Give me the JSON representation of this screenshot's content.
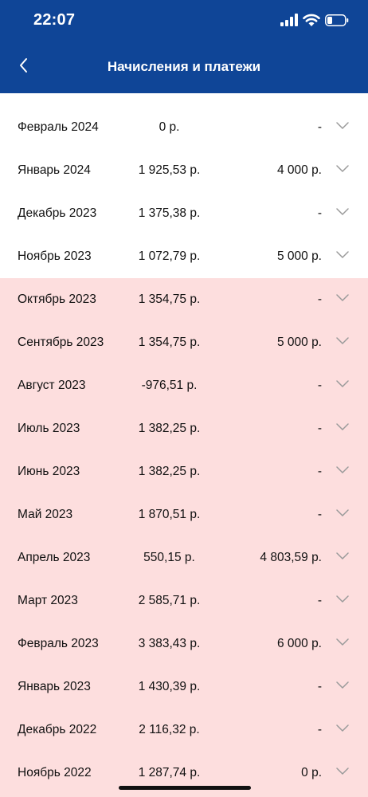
{
  "status_bar": {
    "time": "22:07"
  },
  "header": {
    "title": "Начисления и платежи"
  },
  "colors": {
    "header_bg": "#0f4597",
    "highlight_bg": "#fddede"
  },
  "rows": [
    {
      "month": "Февраль 2024",
      "charge": "0 р.",
      "payment": "-"
    },
    {
      "month": "Январь 2024",
      "charge": "1 925,53 р.",
      "payment": "4 000 р."
    },
    {
      "month": "Декабрь 2023",
      "charge": "1 375,38 р.",
      "payment": "-"
    },
    {
      "month": "Ноябрь 2023",
      "charge": "1 072,79 р.",
      "payment": "5 000 р."
    },
    {
      "month": "Октябрь 2023",
      "charge": "1 354,75 р.",
      "payment": "-"
    },
    {
      "month": "Сентябрь 2023",
      "charge": "1 354,75 р.",
      "payment": "5 000 р."
    },
    {
      "month": "Август 2023",
      "charge": "-976,51 р.",
      "payment": "-"
    },
    {
      "month": "Июль 2023",
      "charge": "1 382,25 р.",
      "payment": "-"
    },
    {
      "month": "Июнь 2023",
      "charge": "1 382,25 р.",
      "payment": "-"
    },
    {
      "month": "Май 2023",
      "charge": "1 870,51 р.",
      "payment": "-"
    },
    {
      "month": "Апрель 2023",
      "charge": "550,15 р.",
      "payment": "4 803,59 р."
    },
    {
      "month": "Март 2023",
      "charge": "2 585,71 р.",
      "payment": "-"
    },
    {
      "month": "Февраль 2023",
      "charge": "3 383,43 р.",
      "payment": "6 000 р."
    },
    {
      "month": "Январь 2023",
      "charge": "1 430,39 р.",
      "payment": "-"
    },
    {
      "month": "Декабрь 2022",
      "charge": "2 116,32 р.",
      "payment": "-"
    },
    {
      "month": "Ноябрь 2022",
      "charge": "1 287,74 р.",
      "payment": "0 р."
    }
  ]
}
